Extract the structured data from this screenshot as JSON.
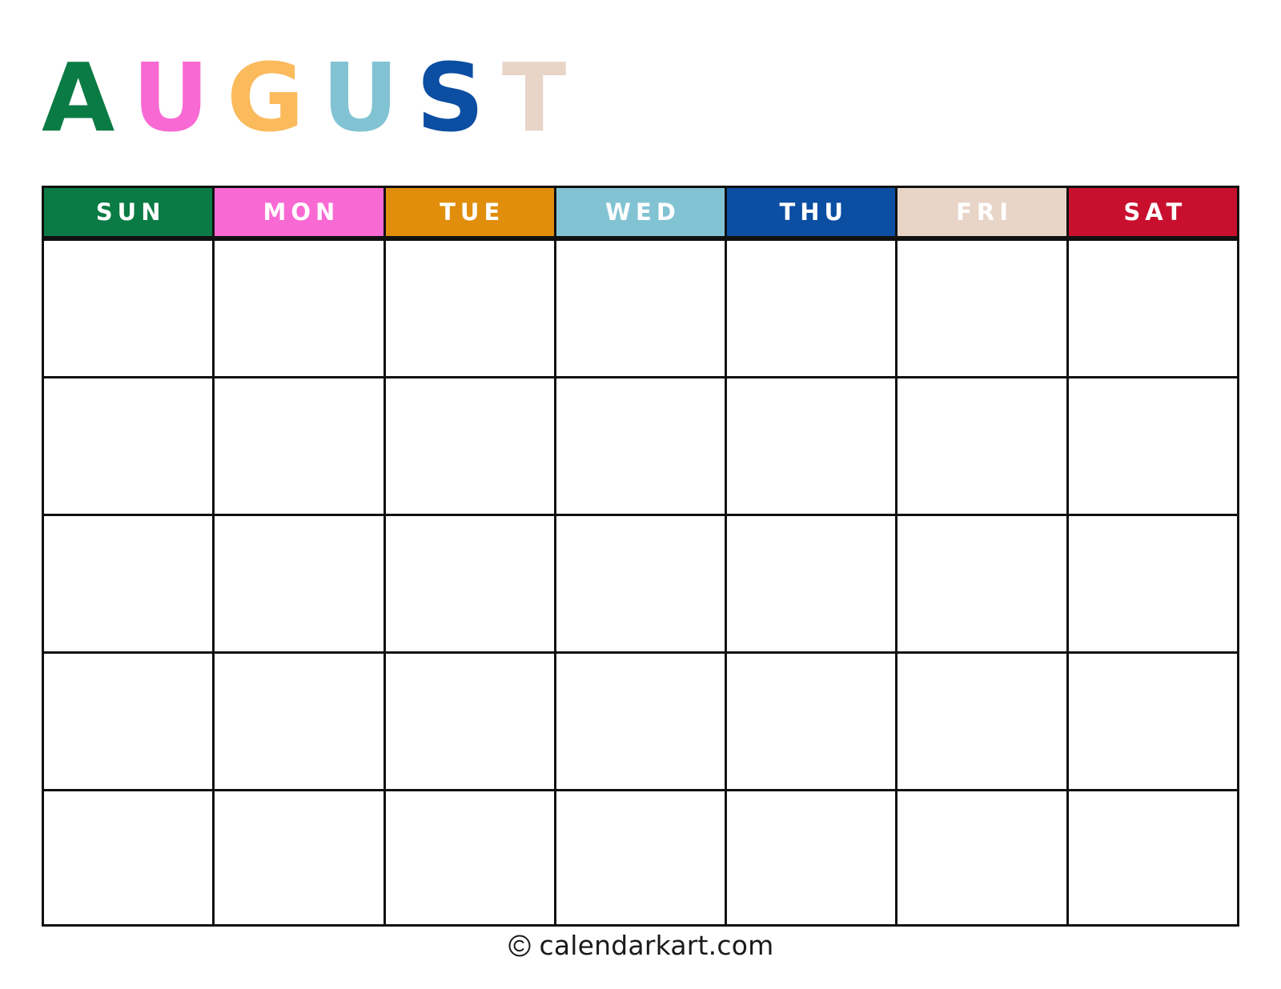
{
  "document": {
    "type": "printable-monthly-calendar",
    "background_color": "#FFFFFF",
    "grid_line_color": "#111111"
  },
  "title": {
    "text": "AUGUST",
    "letters": [
      {
        "char": "A",
        "color": "#0A7B44"
      },
      {
        "char": "U",
        "color": "#F969D3"
      },
      {
        "char": "G",
        "color": "#FBBA5C"
      },
      {
        "char": "U",
        "color": "#82C3D3"
      },
      {
        "char": "S",
        "color": "#0B4EA2"
      },
      {
        "char": "T",
        "color": "#E8D5C8"
      }
    ]
  },
  "weekdays": [
    {
      "label": "SUN",
      "bg": "#0A7B44",
      "fg": "#FFFFFF"
    },
    {
      "label": "MON",
      "bg": "#F969D3",
      "fg": "#FFFFFF"
    },
    {
      "label": "TUE",
      "bg": "#E08E0B",
      "fg": "#FFFFFF"
    },
    {
      "label": "WED",
      "bg": "#82C3D3",
      "fg": "#FFFFFF"
    },
    {
      "label": "THU",
      "bg": "#0B4EA2",
      "fg": "#FFFFFF"
    },
    {
      "label": "FRI",
      "bg": "#E8D5C8",
      "fg": "#FFFFFF"
    },
    {
      "label": "SAT",
      "bg": "#C8102E",
      "fg": "#FFFFFF"
    }
  ],
  "weeks": [
    {
      "days": [
        "",
        "",
        "",
        "",
        "",
        "",
        ""
      ]
    },
    {
      "days": [
        "",
        "",
        "",
        "",
        "",
        "",
        ""
      ]
    },
    {
      "days": [
        "",
        "",
        "",
        "",
        "",
        "",
        ""
      ]
    },
    {
      "days": [
        "",
        "",
        "",
        "",
        "",
        "",
        ""
      ]
    },
    {
      "days": [
        "",
        "",
        "",
        "",
        "",
        "",
        ""
      ]
    }
  ],
  "footer": {
    "copyright_symbol": "©",
    "text": "calendarkart.com"
  }
}
